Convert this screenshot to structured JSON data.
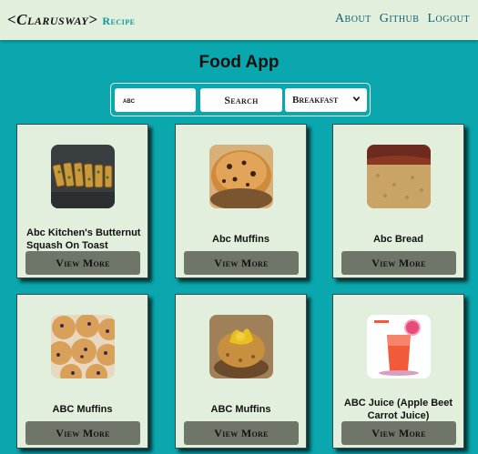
{
  "navbar": {
    "brand": "<Clarusway>",
    "brand_sub": "Recipe",
    "links": [
      "About",
      "Github",
      "Logout"
    ]
  },
  "main": {
    "title": "Food App",
    "search": {
      "query": "abc",
      "button_label": "Search",
      "meal_type": "Breakfast"
    },
    "cards": [
      {
        "title": "Abc Kitchen's Butternut Squash On Toast",
        "button": "View More",
        "image": "butternut-squash-toast-photo"
      },
      {
        "title": "Abc Muffins",
        "button": "View More",
        "image": "chocolate-chip-muffin-photo"
      },
      {
        "title": "Abc Bread",
        "button": "View More",
        "image": "bread-loaf-photo"
      },
      {
        "title": "ABC Muffins",
        "button": "View More",
        "image": "blueberry-muffins-photo"
      },
      {
        "title": "ABC Muffins",
        "button": "View More",
        "image": "muffin-photo"
      },
      {
        "title": "ABC Juice (Apple Beet Carrot Juice)",
        "button": "View More",
        "image": "juice-glass-photo"
      }
    ]
  }
}
